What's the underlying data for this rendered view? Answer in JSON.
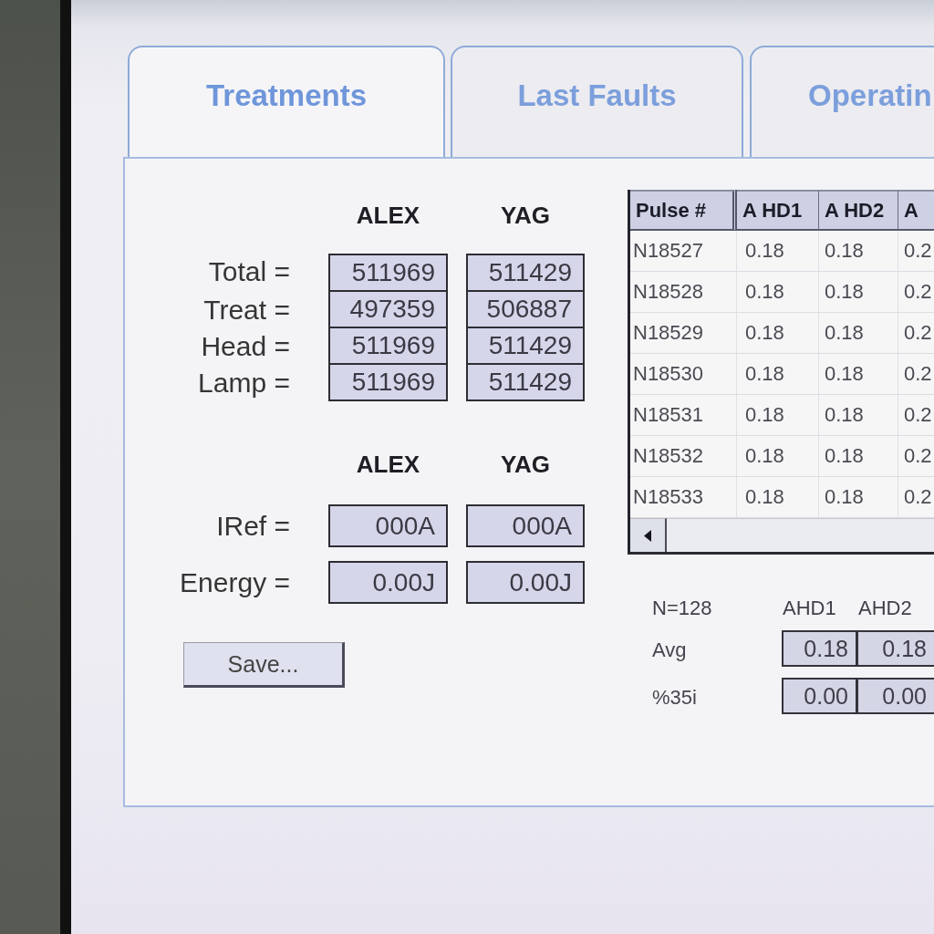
{
  "tabs": [
    {
      "label": "Treatments",
      "selected": true
    },
    {
      "label": "Last Faults",
      "selected": false
    },
    {
      "label": "Operatin",
      "selected": false
    }
  ],
  "counters": {
    "columns": [
      "ALEX",
      "YAG"
    ],
    "rows": [
      {
        "label": "Total =",
        "values": [
          "511969",
          "511429"
        ]
      },
      {
        "label": "Treat =",
        "values": [
          "497359",
          "506887"
        ]
      },
      {
        "label": "Head =",
        "values": [
          "511969",
          "511429"
        ]
      },
      {
        "label": "Lamp =",
        "values": [
          "511969",
          "511429"
        ]
      }
    ]
  },
  "outputs": {
    "columns": [
      "ALEX",
      "YAG"
    ],
    "rows": [
      {
        "label": "IRef =",
        "values": [
          "000A",
          "000A"
        ]
      },
      {
        "label": "Energy =",
        "values": [
          "0.00J",
          "0.00J"
        ]
      }
    ]
  },
  "save_button": {
    "label": "Save..."
  },
  "pulse_table": {
    "columns": [
      "Pulse #",
      "A HD1",
      "A HD2",
      "A"
    ],
    "rows": [
      [
        "N18527",
        "0.18",
        "0.18",
        "0.2"
      ],
      [
        "N18528",
        "0.18",
        "0.18",
        "0.2"
      ],
      [
        "N18529",
        "0.18",
        "0.18",
        "0.2"
      ],
      [
        "N18530",
        "0.18",
        "0.18",
        "0.2"
      ],
      [
        "N18531",
        "0.18",
        "0.18",
        "0.2"
      ],
      [
        "N18532",
        "0.18",
        "0.18",
        "0.2"
      ],
      [
        "N18533",
        "0.18",
        "0.18",
        "0.2"
      ]
    ]
  },
  "statistics": {
    "count": "N=128",
    "columns": [
      "AHD1",
      "AHD2"
    ],
    "rows": [
      {
        "label": "Avg",
        "values": [
          "0.18",
          "0.18"
        ]
      },
      {
        "label": "%35i",
        "values": [
          "0.00",
          "0.00"
        ]
      }
    ]
  }
}
